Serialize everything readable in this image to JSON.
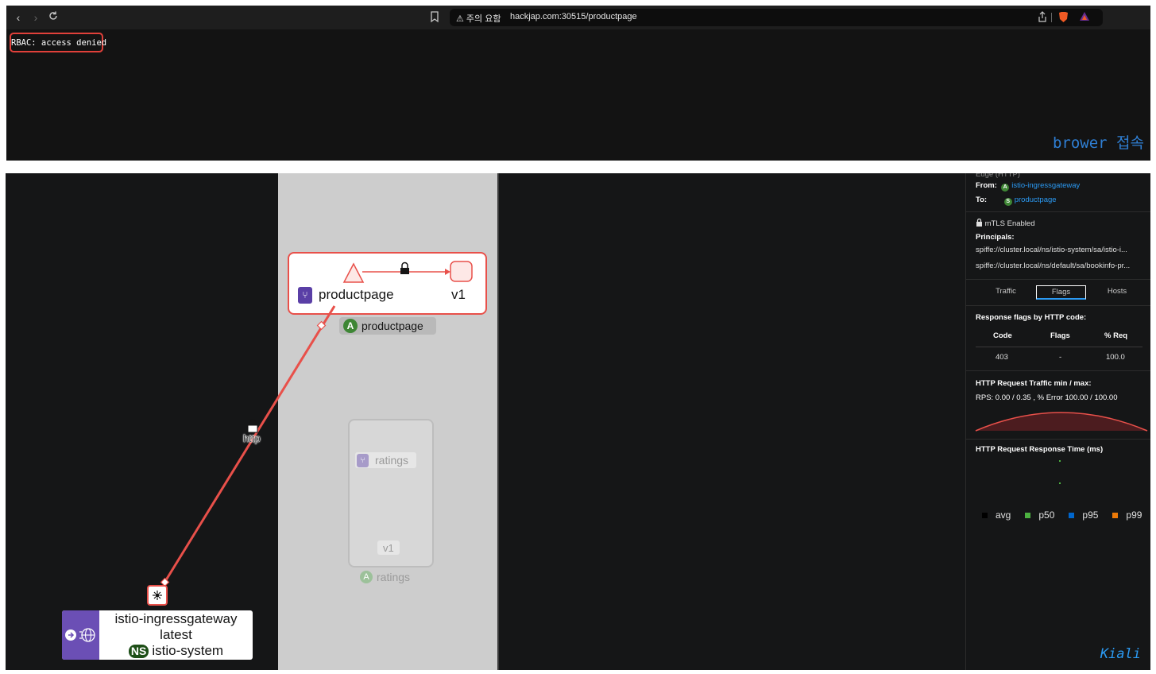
{
  "browser": {
    "security_warning": "⚠ 주의 요함",
    "url": "hackjap.com:30515/productpage",
    "page_text": "RBAC: access denied",
    "annotation": "brower 접속"
  },
  "graph": {
    "productpage_service": "productpage",
    "productpage_version": "v1",
    "productpage_app": "productpage",
    "app_badge": "A",
    "edge_protocol": "http",
    "ratings_service": "ratings",
    "ratings_version": "v1",
    "ratings_app": "ratings",
    "gateway_name": "istio-ingressgateway",
    "gateway_version": "latest",
    "gateway_ns_badge": "NS",
    "gateway_namespace": "istio-system"
  },
  "side_panel": {
    "from_label": "From:",
    "from_value": "istio-ingressgateway",
    "to_label": "To:",
    "to_value": "productpage",
    "from_badge": "A",
    "to_badge": "S",
    "mtls": "mTLS Enabled",
    "principals_label": "Principals:",
    "principal_1": "spiffe://cluster.local/ns/istio-system/sa/istio-i...",
    "principal_2": "spiffe://cluster.local/ns/default/sa/bookinfo-pr...",
    "tabs": [
      "Traffic",
      "Flags",
      "Hosts"
    ],
    "active_tab": "Flags",
    "flags_title": "Response flags by HTTP code:",
    "table_headers": [
      "Code",
      "Flags",
      "% Req"
    ],
    "table_row": [
      "403",
      "-",
      "100.0"
    ],
    "traffic_title": "HTTP Request Traffic min / max:",
    "traffic_stats": "RPS: 0.00 / 0.35 , % Error 100.00 / 100.00",
    "response_time_title": "HTTP Request Response Time (ms)",
    "legend": [
      {
        "label": "avg",
        "color": "#000000"
      },
      {
        "label": "p50",
        "color": "#4cb140"
      },
      {
        "label": "p95",
        "color": "#0066cc"
      },
      {
        "label": "p99",
        "color": "#ec7a08"
      }
    ],
    "logo": "Kiali"
  },
  "colors": {
    "edge_error": "#e8504a",
    "service_purple": "#5a3fa6",
    "app_green": "#3e8635",
    "link_blue": "#2b9af3"
  }
}
